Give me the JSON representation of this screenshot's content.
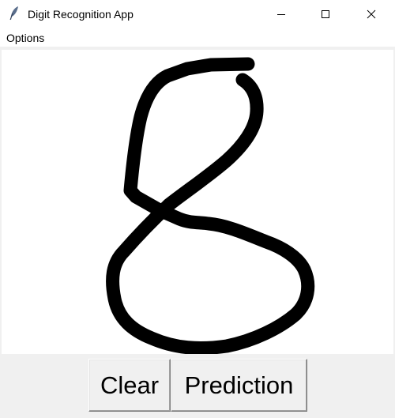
{
  "window": {
    "title": "Digit Recognition App",
    "icon": "feather-icon",
    "controls": [
      "minimize-icon",
      "maximize-icon",
      "close-icon"
    ]
  },
  "menubar": {
    "options_label": "Options"
  },
  "canvas": {
    "content": "handwritten-digit-drawing",
    "stroke_color": "#000000",
    "background_color": "#ffffff"
  },
  "buttons": {
    "clear_label": "Clear",
    "prediction_label": "Prediction"
  }
}
